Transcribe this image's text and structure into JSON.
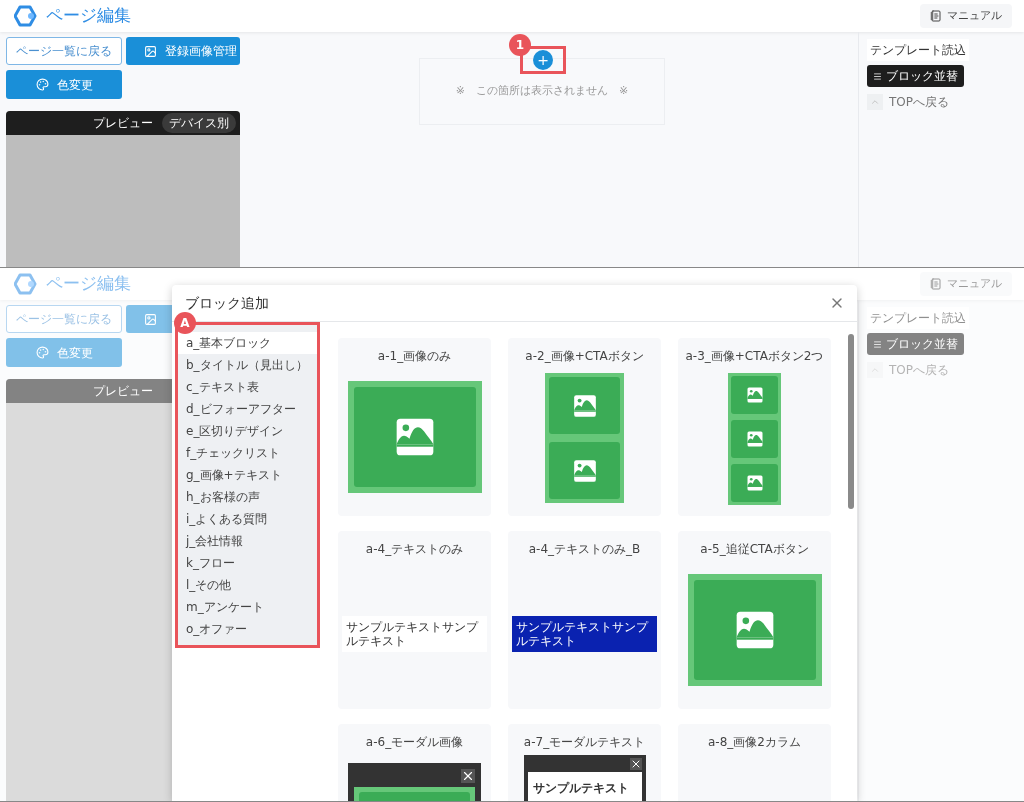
{
  "top_screen": {
    "header": {
      "title": "ページ編集",
      "manual_button": "マニュアル"
    },
    "left_panel": {
      "back_button": "ページ一覧に戻る",
      "images_button": "登録画像管理",
      "color_button": "色変更",
      "preview": {
        "title": "プレビュー",
        "device_button": "デバイス別"
      }
    },
    "canvas": {
      "notice": "※　この箇所は表示されません　※",
      "add_button": "+",
      "callout": "1"
    },
    "right_panel": {
      "template_button": "テンプレート読込",
      "sort_button": "ブロック並替",
      "top_link": "TOPへ戻る"
    }
  },
  "bottom_screen": {
    "header": {
      "title": "ページ編集",
      "manual_button": "マニュアル"
    },
    "left_panel": {
      "back_button": "ページ一覧に戻る",
      "color_button": "色変更",
      "preview": {
        "title": "プレビュー"
      }
    },
    "right_panel": {
      "template_button": "テンプレート読込",
      "sort_button": "ブロック並替",
      "top_link": "TOPへ戻る"
    },
    "modal": {
      "title": "ブロック追加",
      "callout": "A",
      "categories": [
        {
          "label": "a_基本ブロック",
          "selected": true
        },
        {
          "label": "b_タイトル（見出し）",
          "selected": false
        },
        {
          "label": "c_テキスト表",
          "selected": false
        },
        {
          "label": "d_ビフォーアフター",
          "selected": false
        },
        {
          "label": "e_区切りデザイン",
          "selected": false
        },
        {
          "label": "f_チェックリスト",
          "selected": false
        },
        {
          "label": "g_画像+テキスト",
          "selected": false
        },
        {
          "label": "h_お客様の声",
          "selected": false
        },
        {
          "label": "i_よくある質問",
          "selected": false
        },
        {
          "label": "j_会社情報",
          "selected": false
        },
        {
          "label": "k_フロー",
          "selected": false
        },
        {
          "label": "l_その他",
          "selected": false
        },
        {
          "label": "m_アンケート",
          "selected": false
        },
        {
          "label": "o_オファー",
          "selected": false
        }
      ],
      "blocks": [
        {
          "title": "a-1_画像のみ",
          "kind": "single_image"
        },
        {
          "title": "a-2_画像+CTAボタン",
          "kind": "two_images"
        },
        {
          "title": "a-3_画像+CTAボタン2つ",
          "kind": "three_images"
        },
        {
          "title": "a-4_テキストのみ",
          "kind": "text_plain",
          "sample": "サンプルテキストサンプルテキスト"
        },
        {
          "title": "a-4_テキストのみ_B",
          "kind": "text_banner",
          "sample": "サンプルテキストサンプルテキスト"
        },
        {
          "title": "a-5_追従CTAボタン",
          "kind": "single_image"
        },
        {
          "title": "a-6_モーダル画像",
          "kind": "modal_image"
        },
        {
          "title": "a-7_モーダルテキスト",
          "kind": "modal_text",
          "sample": "サンプルテキスト"
        },
        {
          "title": "a-8_画像2カラム",
          "kind": "empty"
        }
      ]
    }
  }
}
